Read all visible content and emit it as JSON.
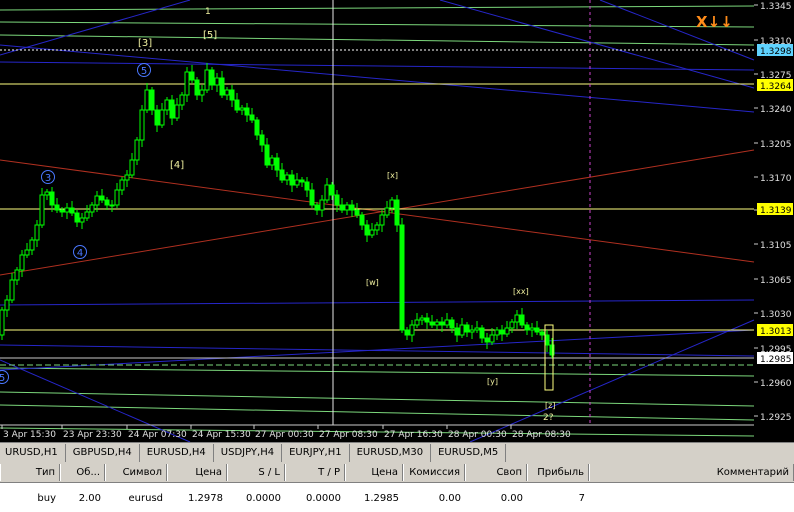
{
  "price_axis": {
    "ticks": [
      "1.3345",
      "1.3310",
      "1.3275",
      "1.3240",
      "1.3205",
      "1.3170",
      "1.3140",
      "1.3105",
      "1.3065",
      "1.3030",
      "1.2995",
      "1.2960",
      "1.2925"
    ],
    "markers": [
      {
        "label": "1.3298",
        "bg": "#5fd3ff",
        "fg": "#000000"
      },
      {
        "label": "1.3264",
        "bg": "#ffff00",
        "fg": "#000000"
      },
      {
        "label": "1.3139",
        "bg": "#ffff00",
        "fg": "#000000"
      },
      {
        "label": "1.3013",
        "bg": "#ffff00",
        "fg": "#000000"
      },
      {
        "label": "1.2985",
        "bg": "#ffffff",
        "fg": "#000000"
      }
    ]
  },
  "time_axis": [
    "3 Apr 15:30",
    "23 Apr 23:30",
    "24 Apr 07:30",
    "24 Apr 15:30",
    "27 Apr 00:30",
    "27 Apr 08:30",
    "27 Apr 16:30",
    "28 Apr 00:30",
    "28 Apr 08:30"
  ],
  "wave_labels": [
    "1",
    "[3]",
    "[5]",
    "(5)",
    "[4]",
    "(3)",
    "(4)",
    "[x]",
    "[w]",
    "[xx]",
    "[y]",
    "[z]",
    "2?",
    "(5)"
  ],
  "signal": {
    "text": "X↓↓",
    "color": "#ff8c1a"
  },
  "colors": {
    "candles": "#00ff00",
    "green_lines": "#7cd87c",
    "blue_lines": "#2626c8",
    "red_line": "#b03020",
    "yellow_levels": "#ffff80",
    "white_lines": "#ffffff",
    "vline": "#cc44cc",
    "labels": "#f0f0a0",
    "circled_labels": "#4a78ff"
  },
  "symbol_tabs": [
    "URUSD,H1",
    "GBPUSD,H4",
    "EURUSD,H4",
    "USDJPY,H4",
    "EURJPY,H1",
    "EURUSD,M30",
    "EURUSD,M5"
  ],
  "terminal": {
    "headers": [
      "Тип",
      "Об...",
      "Символ",
      "Цена",
      "S / L",
      "T / P",
      "Цена",
      "Комиссия",
      "Своп",
      "Прибыль",
      "Комментарий"
    ],
    "rows": [
      [
        "buy",
        "2.00",
        "eurusd",
        "1.2978",
        "0.0000",
        "0.0000",
        "1.2985",
        "0.00",
        "0.00",
        "7",
        ""
      ]
    ]
  }
}
